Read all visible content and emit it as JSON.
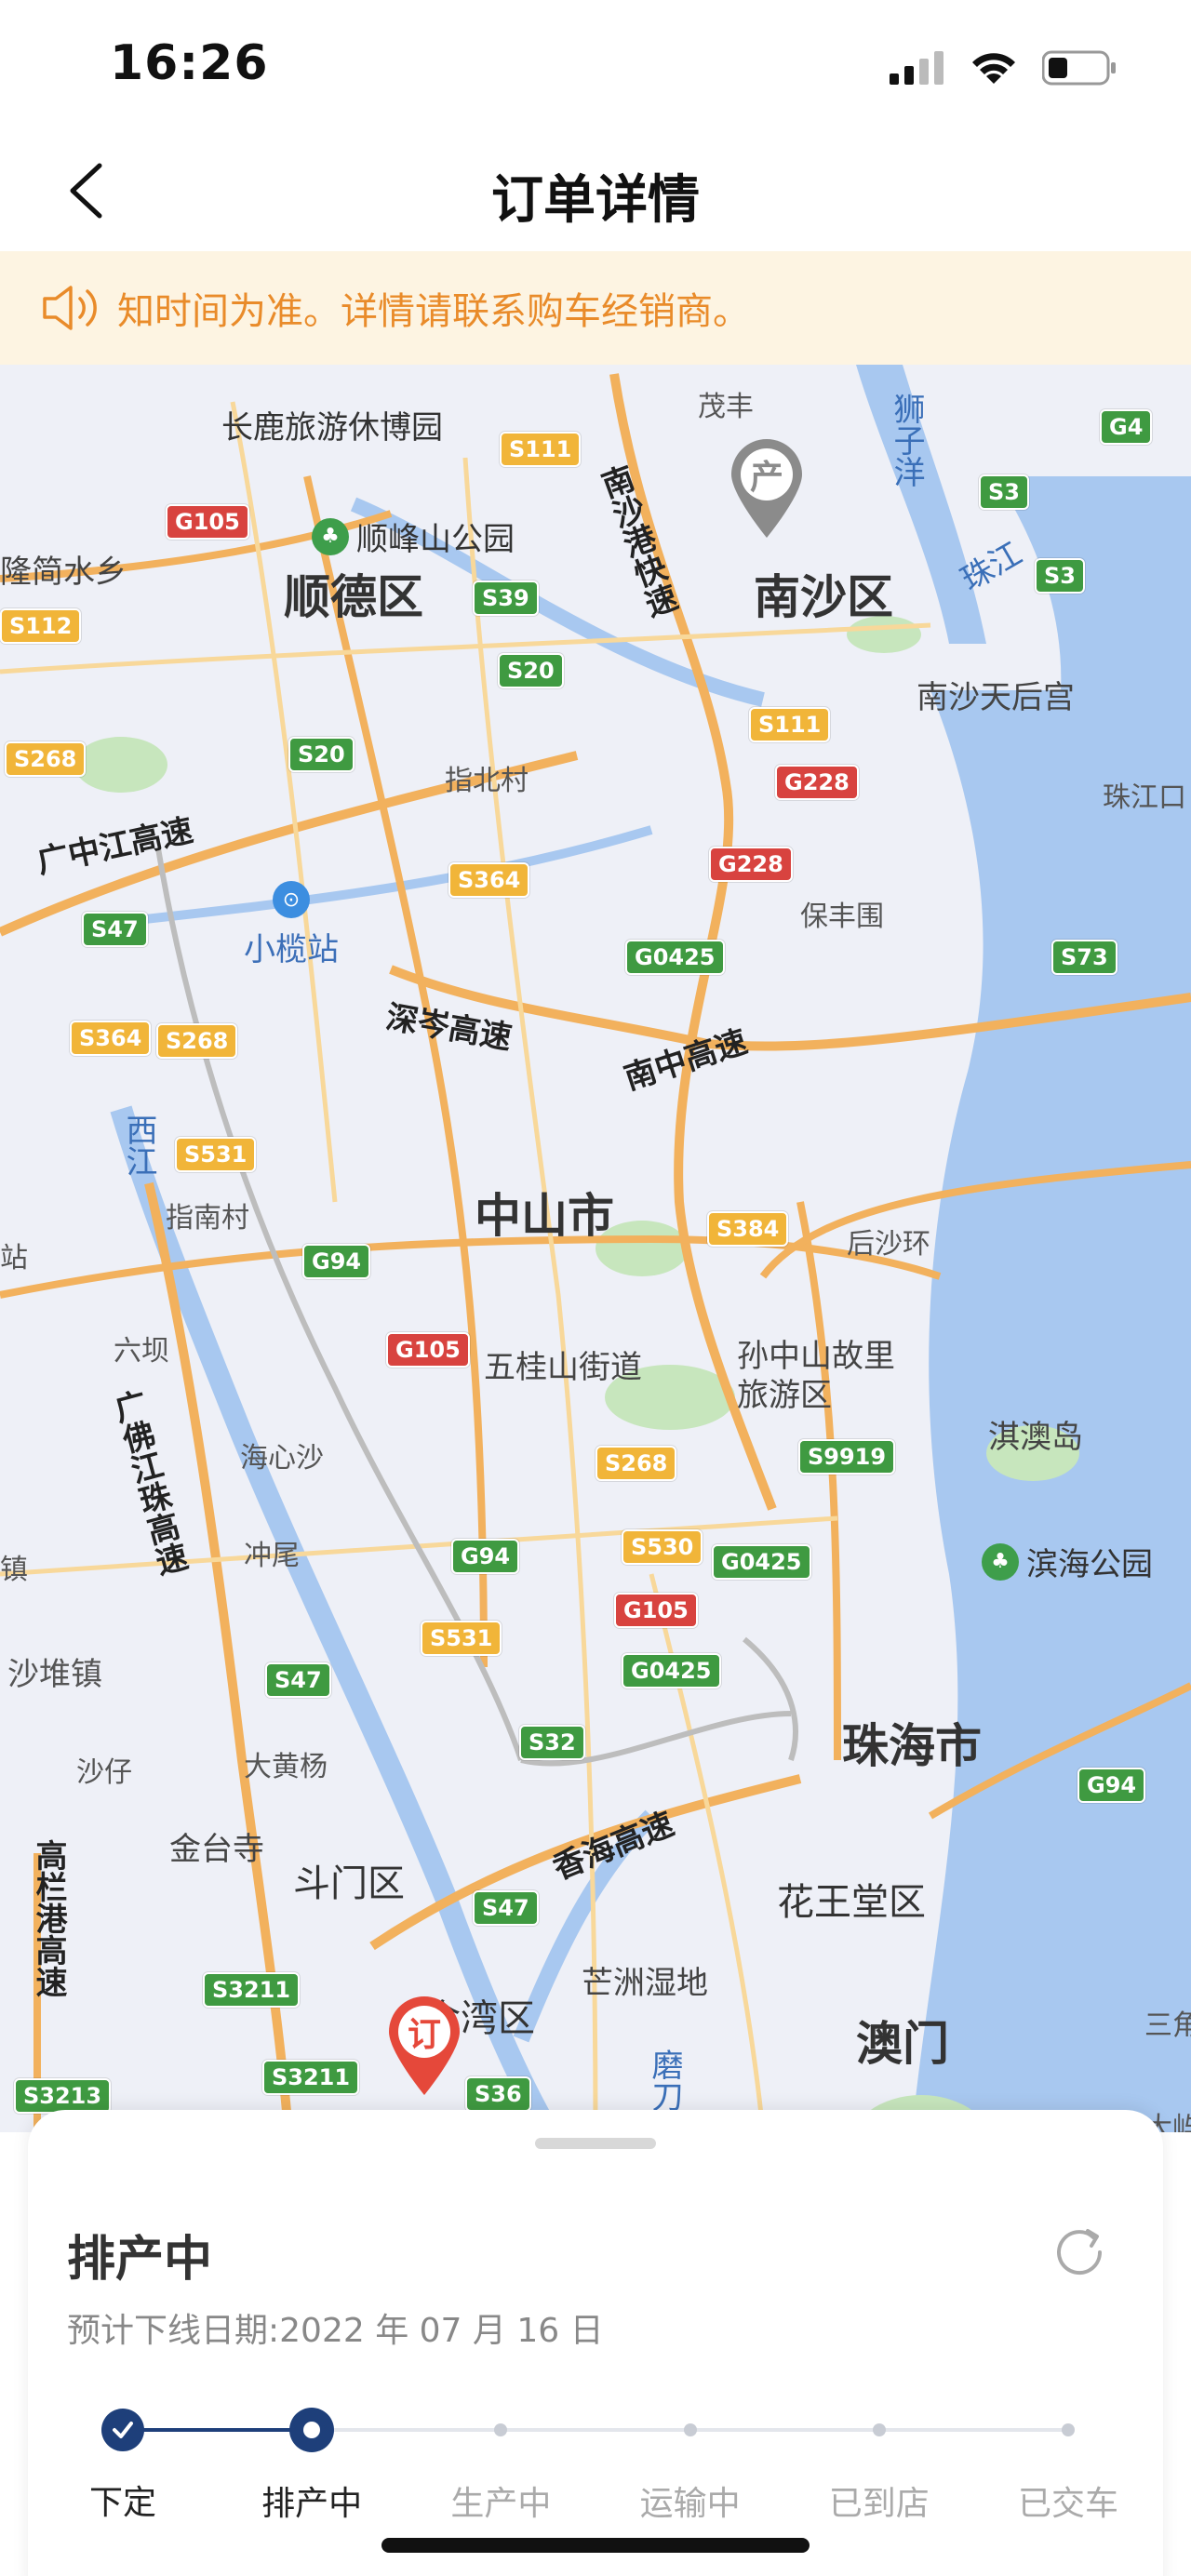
{
  "status_bar": {
    "time": "16:26"
  },
  "header": {
    "title": "订单详情"
  },
  "notice": {
    "text": "知时间为准。详情请联系购车经销商。"
  },
  "map": {
    "pins": [
      {
        "name": "production-pin",
        "label": "产"
      },
      {
        "name": "order-pin",
        "label": "订"
      }
    ],
    "districts": [
      "顺德区",
      "南沙区",
      "中山市",
      "珠海市",
      "斗门区",
      "金湾区",
      "花王堂区",
      "澳门"
    ],
    "places": [
      "长鹿旅游休博园",
      "茂丰",
      "指北村",
      "保丰围",
      "南沙天后宫",
      "珠江口",
      "隆简水乡",
      "指南村",
      "后沙环",
      "五桂山街道",
      "孙中山故里",
      "旅游区",
      "淇澳岛",
      "六坝",
      "海心沙",
      "冲尾",
      "沙堆镇",
      "沙仔",
      "大黄杨",
      "金台寺",
      "芒洲湿地",
      "三角",
      "大屿",
      "西江",
      "狮子洋",
      "珠江",
      "磨刀",
      "镇",
      "站"
    ],
    "pois": [
      "顺峰山公园",
      "小榄站",
      "滨海公园"
    ],
    "highways": [
      "广中江高速",
      "南沙港快速",
      "深岑高速",
      "南中高速",
      "广佛江珠高速",
      "香海高速",
      "高栏港高速"
    ],
    "shields": [
      "G105",
      "S111",
      "G4",
      "S3",
      "S3",
      "S112",
      "S39",
      "S20",
      "S20",
      "S268",
      "S111",
      "G228",
      "G228",
      "S364",
      "S47",
      "G0425",
      "S73",
      "S364",
      "S268",
      "S531",
      "S384",
      "G94",
      "G105",
      "S9919",
      "S268",
      "S530",
      "G0425",
      "G94",
      "G105",
      "S531",
      "G0425",
      "S47",
      "S32",
      "G94",
      "S47",
      "S3211",
      "S3211",
      "S36",
      "S3213"
    ]
  },
  "order": {
    "status": "排产中",
    "eta": "预计下线日期:2022 年 07 月 16 日",
    "steps": [
      {
        "label": "下定",
        "state": "done"
      },
      {
        "label": "排产中",
        "state": "current"
      },
      {
        "label": "生产中",
        "state": "pending"
      },
      {
        "label": "运输中",
        "state": "pending"
      },
      {
        "label": "已到店",
        "state": "pending"
      },
      {
        "label": "已交车",
        "state": "pending"
      }
    ],
    "progress_fraction": 0.2
  },
  "colors": {
    "accent": "#1e3f7a",
    "notice_text": "#e98b2a",
    "notice_bg": "#fdf4e2",
    "order_pin": "#e5483a",
    "production_pin": "#8b8b8b"
  }
}
